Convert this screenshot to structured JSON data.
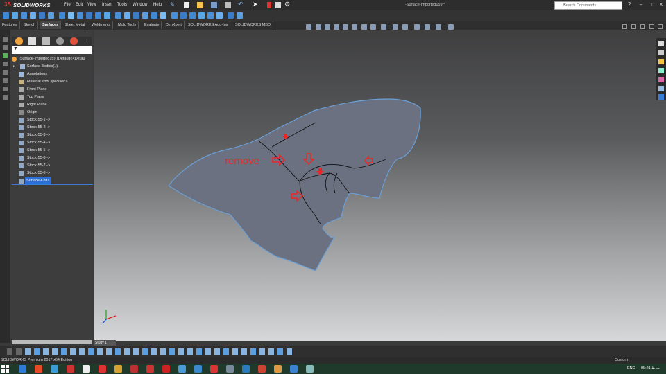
{
  "app": {
    "brand_ds": "3S",
    "brand_name": "SOLIDWORKS",
    "menu": [
      "File",
      "Edit",
      "View",
      "Insert",
      "Tools",
      "Window",
      "Help"
    ],
    "document_title": "-Surface-Imported159 *",
    "search_placeholder": "Search Commands"
  },
  "tabs": [
    {
      "label": "Features",
      "active": false
    },
    {
      "label": "Sketch",
      "active": false
    },
    {
      "label": "Surfaces",
      "active": true
    },
    {
      "label": "Sheet Metal",
      "active": false
    },
    {
      "label": "Weldments",
      "active": false
    },
    {
      "label": "Mold Tools",
      "active": false
    },
    {
      "label": "Evaluate",
      "active": false
    },
    {
      "label": "DimXpert",
      "active": false
    },
    {
      "label": "SOLIDWORKS Add-Ins",
      "active": false
    },
    {
      "label": "SOLIDWORKS MBD",
      "active": false
    }
  ],
  "feature_tree": {
    "root": "-Surface-Imported159  (Default<<Defau",
    "items": [
      {
        "label": "Surface Bodies(1)",
        "icon": "folder-icon"
      },
      {
        "label": "Annotations",
        "icon": "annotations-icon"
      },
      {
        "label": "Material <not specified>",
        "icon": "material-icon"
      },
      {
        "label": "Front Plane",
        "icon": "plane-icon"
      },
      {
        "label": "Top Plane",
        "icon": "plane-icon"
      },
      {
        "label": "Right Plane",
        "icon": "plane-icon"
      },
      {
        "label": "Origin",
        "icon": "origin-icon"
      },
      {
        "label": "Stock-55-1 ->",
        "icon": "sketch-icon"
      },
      {
        "label": "Stock-55-2 ->",
        "icon": "sketch-icon"
      },
      {
        "label": "Stock-55-3 ->",
        "icon": "sketch-icon"
      },
      {
        "label": "Stock-55-4 ->",
        "icon": "sketch-icon"
      },
      {
        "label": "Stock-55-5 ->",
        "icon": "sketch-icon"
      },
      {
        "label": "Stock-55-6 ->",
        "icon": "sketch-icon"
      },
      {
        "label": "Stock-55-7 ->",
        "icon": "sketch-icon"
      },
      {
        "label": "Stock-55-8 ->",
        "icon": "sketch-icon"
      }
    ],
    "selected": "Surface-Knit1"
  },
  "viewport": {
    "annotation_text": "remove"
  },
  "bottom": {
    "study_tab": "Study 1",
    "status_text": "SOLIDWORKS Premium 2017 x64 Edition",
    "unit_system": "Custom"
  },
  "taskbar": {
    "language": "ENG",
    "time": "05:21 ب.ظ"
  },
  "colors": {
    "accent": "#2d6fd6",
    "annotation_red": "#e82828",
    "surface": "#6b7180"
  }
}
